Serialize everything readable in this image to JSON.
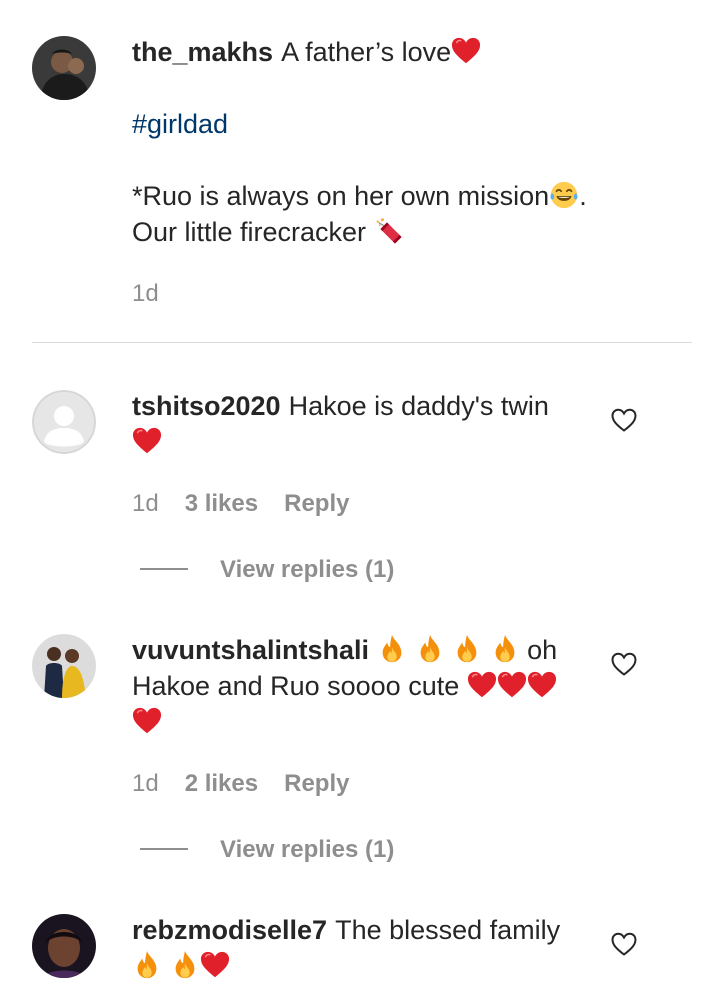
{
  "post": {
    "username": "the_makhs",
    "caption_line1": "A father’s love",
    "hashtag": "#girldad",
    "caption_line3": "*Ruo is always on her own mission",
    "caption_line3_end": ".",
    "caption_line4": "Our little firecracker",
    "time": "1d"
  },
  "comments": [
    {
      "username": "tshitso2020",
      "text": "Hakoe is daddy's twin",
      "time": "1d",
      "likes": "3 likes",
      "reply_label": "Reply",
      "view_replies": "View replies (1)"
    },
    {
      "username": "vuvuntshalintshali",
      "text_a": "oh",
      "text_b": "Hakoe and Ruo soooo cute",
      "time": "1d",
      "likes": "2 likes",
      "reply_label": "Reply",
      "view_replies": "View replies (1)"
    },
    {
      "username": "rebzmodiselle7",
      "text": "The blessed family"
    }
  ],
  "icons": {
    "heart_emoji": "red-heart-emoji",
    "fire_emoji": "fire-emoji",
    "laugh_emoji": "tears-of-joy-emoji",
    "firecracker_emoji": "firecracker-emoji",
    "like_button": "heart-outline-icon"
  },
  "colors": {
    "text": "#262626",
    "muted": "#8e8e8e",
    "hashtag": "#00376b",
    "heart": "#e0202a"
  }
}
